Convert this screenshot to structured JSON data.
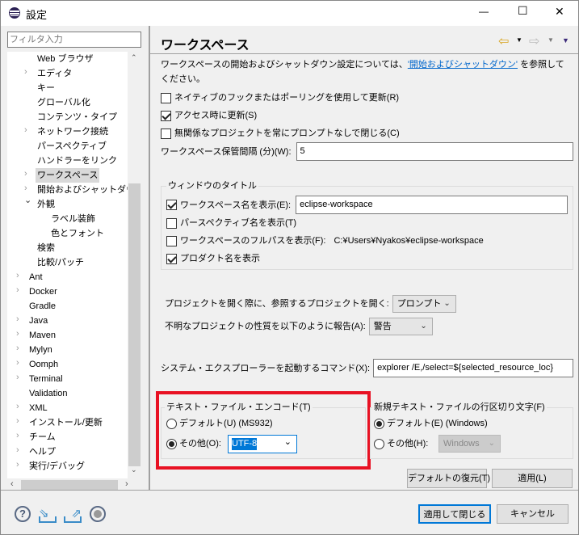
{
  "window": {
    "title": "設定",
    "minimize": "—",
    "maximize": "☐",
    "close": "✕"
  },
  "filter": {
    "placeholder": "フィルタ入力"
  },
  "tree": [
    {
      "label": "Web ブラウザ",
      "level": 1,
      "expandable": false
    },
    {
      "label": "エディタ",
      "level": 1,
      "expandable": true
    },
    {
      "label": "キー",
      "level": 1,
      "expandable": false
    },
    {
      "label": "グローバル化",
      "level": 1,
      "expandable": false
    },
    {
      "label": "コンテンツ・タイプ",
      "level": 1,
      "expandable": false
    },
    {
      "label": "ネットワーク接続",
      "level": 1,
      "expandable": true
    },
    {
      "label": "パースペクティブ",
      "level": 1,
      "expandable": false
    },
    {
      "label": "ハンドラーをリンク",
      "level": 1,
      "expandable": false
    },
    {
      "label": "ワークスペース",
      "level": 1,
      "expandable": true,
      "selected": true
    },
    {
      "label": "開始およびシャットダウン",
      "level": 1,
      "expandable": true
    },
    {
      "label": "外観",
      "level": 1,
      "expanded": true
    },
    {
      "label": "ラベル装飾",
      "level": 2,
      "expandable": false
    },
    {
      "label": "色とフォント",
      "level": 2,
      "expandable": false
    },
    {
      "label": "検索",
      "level": 1,
      "expandable": false
    },
    {
      "label": "比較/パッチ",
      "level": 1,
      "expandable": false
    },
    {
      "label": "Ant",
      "level": 0,
      "expandable": true
    },
    {
      "label": "Docker",
      "level": 0,
      "expandable": true
    },
    {
      "label": "Gradle",
      "level": 0,
      "expandable": false
    },
    {
      "label": "Java",
      "level": 0,
      "expandable": true
    },
    {
      "label": "Maven",
      "level": 0,
      "expandable": true
    },
    {
      "label": "Mylyn",
      "level": 0,
      "expandable": true
    },
    {
      "label": "Oomph",
      "level": 0,
      "expandable": true
    },
    {
      "label": "Terminal",
      "level": 0,
      "expandable": true
    },
    {
      "label": "Validation",
      "level": 0,
      "expandable": false
    },
    {
      "label": "XML",
      "level": 0,
      "expandable": true
    },
    {
      "label": "インストール/更新",
      "level": 0,
      "expandable": true
    },
    {
      "label": "チーム",
      "level": 0,
      "expandable": true
    },
    {
      "label": "ヘルプ",
      "level": 0,
      "expandable": true
    },
    {
      "label": "実行/デバッグ",
      "level": 0,
      "expandable": true
    }
  ],
  "page": {
    "title": "ワークスペース",
    "intro_prefix": "ワークスペースの開始およびシャットダウン設定については、",
    "intro_link": "'開始およびシャットダウン'",
    "intro_suffix": " を参照してください。",
    "options": [
      {
        "label": "ネイティブのフックまたはポーリングを使用して更新(R)",
        "checked": false
      },
      {
        "label": "アクセス時に更新(S)",
        "checked": true
      },
      {
        "label": "無関係なプロジェクトを常にプロンプトなしで閉じる(C)",
        "checked": false
      }
    ],
    "save_interval_label": "ワークスペース保管間隔 (分)(W):",
    "save_interval_value": "5",
    "window_title": {
      "label": "ウィンドウのタイトル",
      "show_workspace_name": {
        "label": "ワークスペース名を表示(E):",
        "checked": true,
        "value": "eclipse-workspace"
      },
      "show_perspective": {
        "label": "パースペクティブ名を表示(T)",
        "checked": false
      },
      "show_full_path": {
        "label": "ワークスペースのフルパスを表示(F):",
        "checked": false,
        "value": "C:¥Users¥Nyakos¥eclipse-workspace"
      },
      "show_product": {
        "label": "プロダクト名を表示",
        "checked": true
      }
    },
    "open_referenced_label": "プロジェクトを開く際に、参照するプロジェクトを開く:",
    "open_referenced_value": "プロンプト",
    "unknown_nature_label": "不明なプロジェクトの性質を以下のように報告(A):",
    "unknown_nature_value": "警告",
    "explorer_cmd_label": "システム・エクスプローラーを起動するコマンド(X):",
    "explorer_cmd_value": "explorer /E,/select=${selected_resource_loc}",
    "encoding": {
      "label": "テキスト・ファイル・エンコード(T)",
      "default_label": "デフォルト(U) (MS932)",
      "other_label": "その他(O):",
      "other_value": "UTF-8",
      "selected": "other"
    },
    "line_delimiter": {
      "label": "新規テキスト・ファイルの行区切り文字(F)",
      "default_label": "デフォルト(E) (Windows)",
      "other_label": "その他(H):",
      "other_value": "Windows",
      "selected": "default"
    },
    "restore_defaults": "デフォルトの復元(T)",
    "apply": "適用(L)"
  },
  "footer": {
    "apply_close": "適用して閉じる",
    "cancel": "キャンセル"
  },
  "colors": {
    "highlight": "#e81123",
    "accent": "#0078d7",
    "link": "#0066cc"
  }
}
